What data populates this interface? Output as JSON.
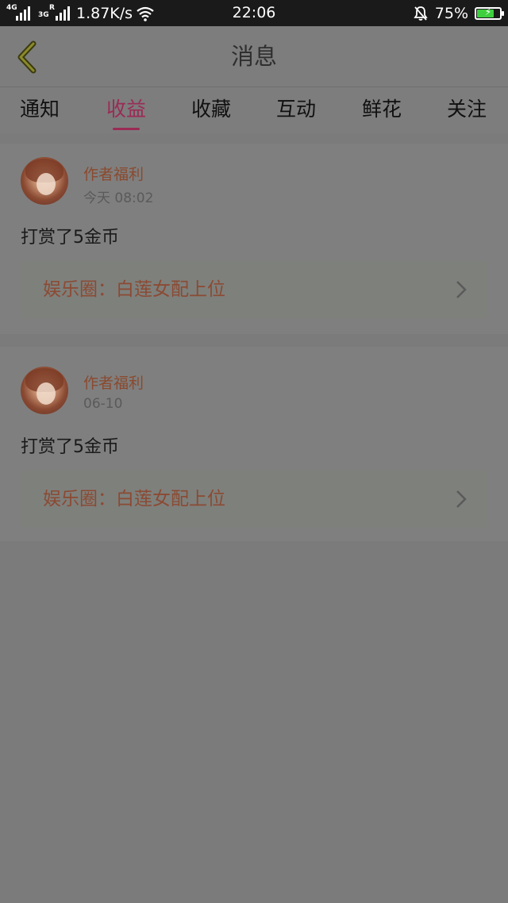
{
  "status_bar": {
    "signal1_label": "4G",
    "signal2_label": "3G",
    "signal2_sub": "R",
    "net_speed": "1.87K/s",
    "time": "22:06",
    "battery_percent": "75%",
    "battery_level": 0.75,
    "wifi_icon": "wifi-icon",
    "bell_icon": "bell-muted-icon"
  },
  "header": {
    "back_icon": "chevron-left-icon",
    "title": "消息"
  },
  "tabs": [
    {
      "label": "通知"
    },
    {
      "label": "收益",
      "active": true
    },
    {
      "label": "收藏"
    },
    {
      "label": "互动"
    },
    {
      "label": "鲜花"
    },
    {
      "label": "关注"
    }
  ],
  "items": [
    {
      "name": "作者福利",
      "time": "今天 08:02",
      "message": "打赏了5金币",
      "link": "娱乐圈：白莲女配上位"
    },
    {
      "name": "作者福利",
      "time": "06-10",
      "message": "打赏了5金币",
      "link": "娱乐圈：白莲女配上位"
    }
  ],
  "colors": {
    "accent": "#9a2b55",
    "name_color": "#8a4a2f",
    "overlay_bg": "#7b7b7b"
  }
}
